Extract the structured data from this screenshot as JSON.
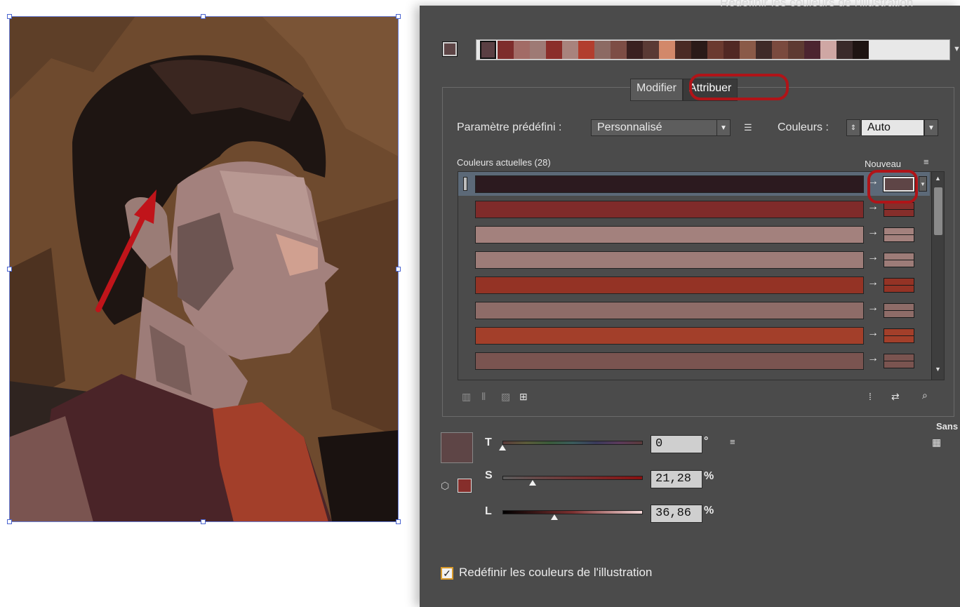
{
  "dialog": {
    "title": "Redéfinir les couleurs de l'illustration",
    "harmony_colors": [
      "#5a3f43",
      "#7e2d2c",
      "#a26b66",
      "#9e7a75",
      "#8b2e2a",
      "#a8837d",
      "#b23e2e",
      "#8c6a63",
      "#7d4d45",
      "#3a2020",
      "#5a3a35",
      "#d2886a",
      "#4a2a24",
      "#2a1a18",
      "#6b3a30",
      "#512824",
      "#8a5a48",
      "#3f2a28",
      "#7a4a3e",
      "#5e3a32",
      "#4c2430",
      "#cfa7a4",
      "#3a2a2a",
      "#1e1412"
    ],
    "tabs": [
      {
        "label": "Modifier"
      },
      {
        "label": "Attribuer"
      }
    ],
    "preset_label": "Paramètre prédéfini :",
    "preset_value": "Personnalisé",
    "colors_label": "Couleurs :",
    "colors_value": "Auto",
    "current_colors_label": "Couleurs actuelles (28)",
    "new_label": "Nouveau",
    "color_rows": [
      {
        "bar": "#2c1a1f",
        "new": "#5e4546"
      },
      {
        "bar": "#7f2b2a",
        "new": "#862e2b"
      },
      {
        "bar": "#a3817d",
        "new": "#a3817d"
      },
      {
        "bar": "#9d7c78",
        "new": "#9d7c78"
      },
      {
        "bar": "#943325",
        "new": "#943325"
      },
      {
        "bar": "#8e6c68",
        "new": "#8e6c68"
      },
      {
        "bar": "#a33f2a",
        "new": "#a33f2a"
      },
      {
        "bar": "#7a5450",
        "new": "#7a5450"
      }
    ],
    "sans_label": "Sans",
    "hsl": {
      "h_label": "T",
      "h_value": "0",
      "h_unit": "°",
      "h_level": 0.0,
      "s_label": "S",
      "s_value": "21,28",
      "s_unit": "%",
      "s_level": 0.2128,
      "l_label": "L",
      "l_value": "36,86",
      "l_unit": "%",
      "l_level": 0.3686
    },
    "recolor_label": "Redéfinir les couleurs de l'illustration",
    "recolor_checked": true
  }
}
